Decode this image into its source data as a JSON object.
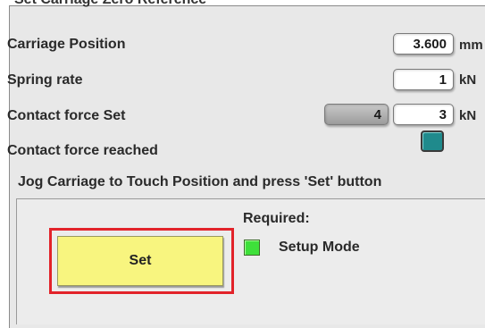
{
  "groupbox": {
    "title": "Set Carriage Zero Reference"
  },
  "carriage_position": {
    "label": "Carriage Position",
    "value": "3.600",
    "unit": "mm"
  },
  "spring_rate": {
    "label": "Spring rate",
    "value": "1",
    "unit": "kN"
  },
  "contact_force_set": {
    "label": "Contact force Set",
    "actual_value": "4",
    "value": "3",
    "unit": "kN"
  },
  "contact_force_reached": {
    "label": "Contact force reached",
    "indicator_color": "#1f8a8c"
  },
  "jog_panel": {
    "title": "Jog Carriage to Touch Position and press 'Set' button",
    "set_button_label": "Set",
    "required_label": "Required:",
    "setup_mode_label": "Setup Mode",
    "setup_mode_led_color": "#3ee03a",
    "highlight_color": "#e2232a"
  }
}
